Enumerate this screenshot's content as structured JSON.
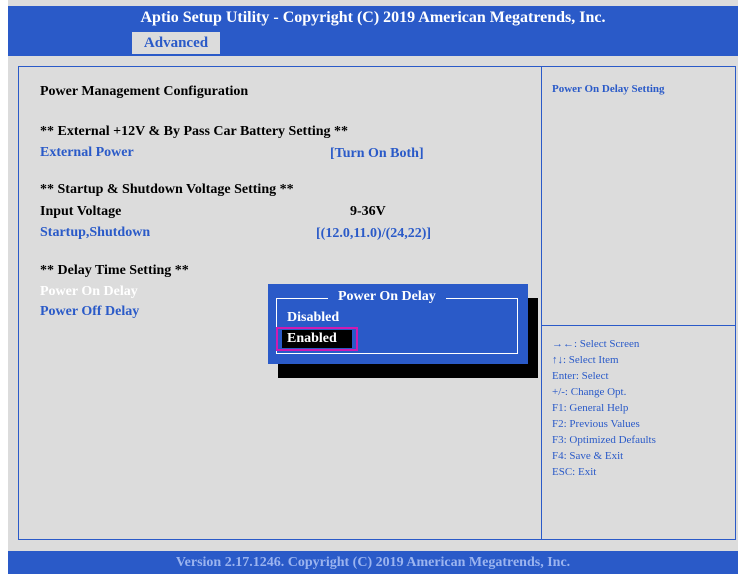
{
  "header": {
    "title": "Aptio Setup Utility - Copyright (C) 2019 American Megatrends, Inc.",
    "tab_active": "Advanced"
  },
  "main": {
    "section_title": "Power Management Configuration",
    "group1_heading": "** External +12V & By Pass Car Battery Setting **",
    "external_power_label": "External Power",
    "external_power_value": "[Turn On Both]",
    "group2_heading": "** Startup & Shutdown Voltage Setting **",
    "input_voltage_label": "Input Voltage",
    "input_voltage_value": "9-36V",
    "startup_shutdown_label": "Startup,Shutdown",
    "startup_shutdown_value": "[(12.0,11.0)/(24,22)]",
    "group3_heading": "** Delay Time Setting **",
    "power_on_delay_label": "Power On Delay",
    "power_off_delay_label": "Power Off Delay"
  },
  "popup": {
    "title": "Power On Delay",
    "options": [
      "Disabled",
      "Enabled"
    ],
    "selected": "Enabled"
  },
  "help": {
    "title": "Power On Delay Setting",
    "keys": [
      "→←: Select Screen",
      "↑↓: Select Item",
      "Enter: Select",
      "+/-: Change Opt.",
      "F1: General Help",
      "F2: Previous Values",
      "F3: Optimized Defaults",
      "F4: Save & Exit",
      "ESC: Exit"
    ]
  },
  "footer": {
    "version": "Version 2.17.1246. Copyright (C) 2019 American Megatrends, Inc."
  },
  "colors": {
    "bios_blue": "#2a5ac8",
    "background_gray": "#dcdcdc",
    "highlight_magenta": "#d01ab0"
  }
}
